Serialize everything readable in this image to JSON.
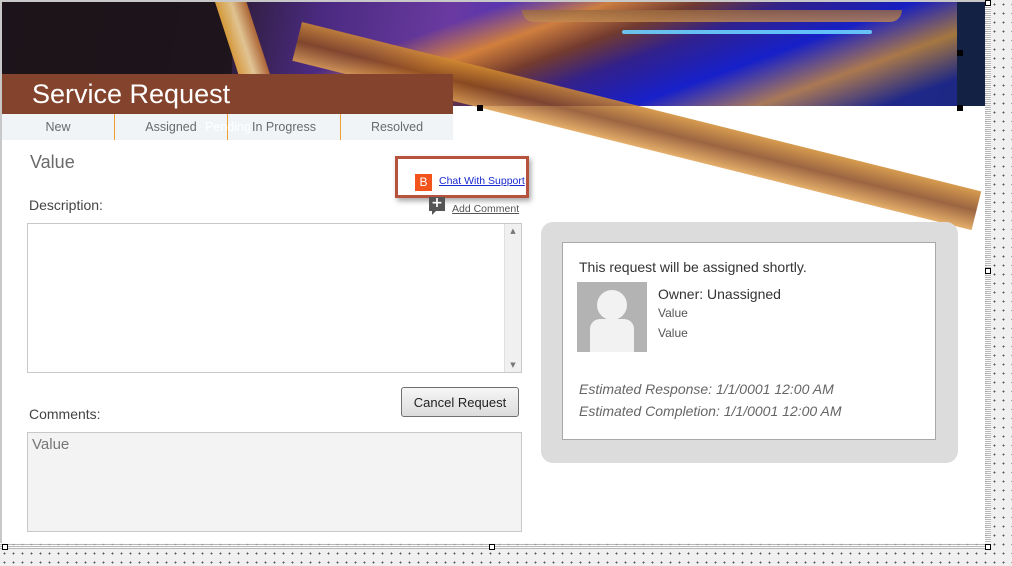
{
  "header": {
    "title": "Service Request",
    "status_steps": [
      "New",
      "Assigned",
      "In Progress",
      "Resolved"
    ],
    "ghost_step": "Pending"
  },
  "form": {
    "value_heading": "Value",
    "chat_icon_letter": "B",
    "chat_link": "Chat With Support",
    "add_comment_link": "Add Comment",
    "description_label": "Description:",
    "description_value": "",
    "cancel_button": "Cancel Request",
    "comments_label": "Comments:",
    "comments_value": "Value"
  },
  "assignment": {
    "message": "This request will be assigned shortly.",
    "owner": "Owner: Unassigned",
    "detail_1": "Value",
    "detail_2": "Value",
    "estimated_response": "Estimated Response: 1/1/0001 12:00 AM",
    "estimated_completion": "Estimated Completion: 1/1/0001 12:00 AM"
  },
  "colors": {
    "title_bar": "#84432c",
    "status_divider": "#f0a030",
    "chat_highlight": "#b5533e",
    "chat_icon": "#f2541b",
    "link": "#1a2bd0"
  }
}
